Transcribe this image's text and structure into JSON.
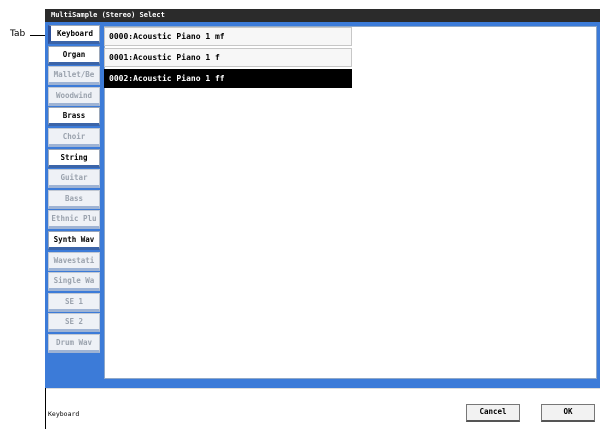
{
  "window": {
    "title": "MultiSample (Stereo) Select"
  },
  "callout": {
    "label": "Tab"
  },
  "tabs": [
    {
      "label": "Keyboard",
      "state": "active"
    },
    {
      "label": "Organ",
      "state": "enabled"
    },
    {
      "label": "Mallet/Be",
      "state": "dim"
    },
    {
      "label": "Woodwind",
      "state": "dim"
    },
    {
      "label": "Brass",
      "state": "enabled"
    },
    {
      "label": "Choir",
      "state": "dim"
    },
    {
      "label": "String",
      "state": "enabled"
    },
    {
      "label": "Guitar",
      "state": "dim"
    },
    {
      "label": "Bass",
      "state": "dim"
    },
    {
      "label": "Ethnic Plu",
      "state": "dim"
    },
    {
      "label": "Synth Wav",
      "state": "enabled"
    },
    {
      "label": "Wavestati",
      "state": "dim"
    },
    {
      "label": "Single Wa",
      "state": "dim"
    },
    {
      "label": "SE 1",
      "state": "dim"
    },
    {
      "label": "SE 2",
      "state": "dim"
    },
    {
      "label": "Drum Wav",
      "state": "dim"
    }
  ],
  "list": {
    "items": [
      {
        "label": "0000:Acoustic Piano 1 mf",
        "selected": false
      },
      {
        "label": "0001:Acoustic Piano 1 f",
        "selected": false
      },
      {
        "label": "0002:Acoustic Piano 1 ff",
        "selected": true
      }
    ]
  },
  "footer": {
    "status": "Keyboard",
    "cancel_label": "Cancel",
    "ok_label": "OK"
  },
  "colors": {
    "panel": "#3c7bd8",
    "titlebar": "#2b2b2b",
    "selected_row": "#000000"
  }
}
